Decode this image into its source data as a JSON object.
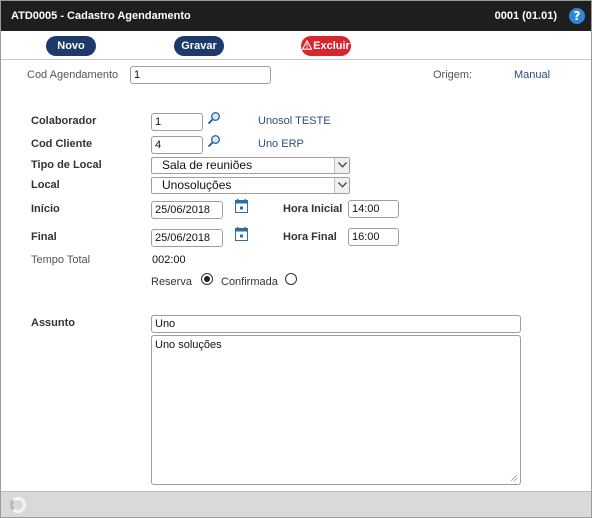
{
  "titlebar": {
    "title": "ATD0005 - Cadastro Agendamento",
    "code": "0001 (01.01)",
    "help_label": "?"
  },
  "toolbar": {
    "novo_label": "Novo",
    "gravar_label": "Gravar",
    "excluir_label": "Excluir"
  },
  "header": {
    "cod_agendamento_label": "Cod Agendamento",
    "cod_agendamento_value": "1",
    "origem_label": "Origem:",
    "origem_value": "Manual"
  },
  "form": {
    "colaborador_label": "Colaborador",
    "colaborador_value": "1",
    "colaborador_name": "Unosol TESTE",
    "cod_cliente_label": "Cod Cliente",
    "cod_cliente_value": "4",
    "cod_cliente_name": "Uno ERP",
    "tipo_local_label": "Tipo de Local",
    "tipo_local_value": "Sala de reuniões",
    "local_label": "Local",
    "local_value": "Unosoluções",
    "inicio_label": "Início",
    "inicio_value": "25/06/2018",
    "hora_inicial_label": "Hora Inicial",
    "hora_inicial_value": "14:00",
    "final_label": "Final",
    "final_value": "25/06/2018",
    "hora_final_label": "Hora Final",
    "hora_final_value": "16:00",
    "tempo_total_label": "Tempo Total",
    "tempo_total_value": "002:00",
    "reserva_label": "Reserva",
    "confirmada_label": "Confirmada",
    "assunto_label": "Assunto",
    "assunto_value": "Uno",
    "descricao_value": "Uno soluções"
  },
  "colors": {
    "titlebar_bg": "#1e1e1e",
    "primary_button": "#1d3a6b",
    "danger_button": "#d8262e",
    "help_icon": "#2f86d6",
    "link_text": "#2a4f7a",
    "statusbar_bg": "#d9d9d9"
  }
}
